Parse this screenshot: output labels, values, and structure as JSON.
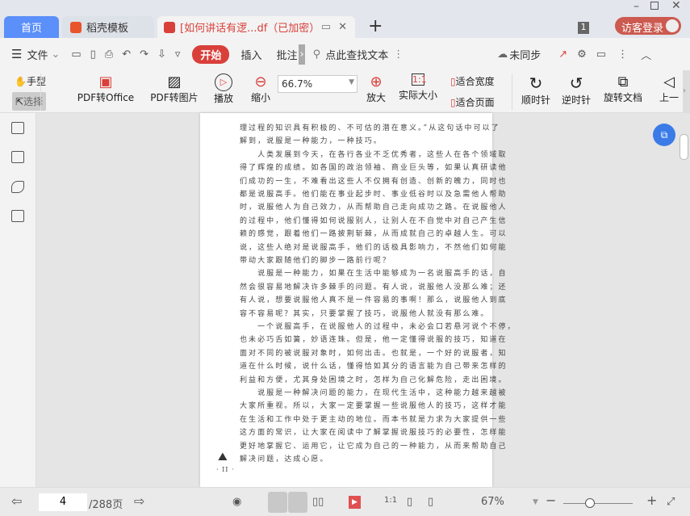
{
  "tabs": {
    "home": "首页",
    "template": "稻壳模板",
    "doc": "[如何讲话有逻...df（已加密）",
    "new": "+"
  },
  "window": {
    "badge": "1",
    "login": "访客登录"
  },
  "toolbar": {
    "menu": "文件",
    "start": "开始",
    "insert": "插入",
    "annotate": "批注",
    "search": "点此查找文本",
    "sync": "未同步"
  },
  "ribbon": {
    "hand": "手型",
    "select": "选择",
    "pdf_office": "PDF转Office",
    "pdf_image": "PDF转图片",
    "play": "播放",
    "zoom_out": "缩小",
    "zoom_value": "66.7%",
    "zoom_in": "放大",
    "actual": "实际大小",
    "fit_width": "适合宽度",
    "fit_page": "适合页面",
    "clockwise": "顺时针",
    "counter": "逆时针",
    "rotate_doc": "旋转文档",
    "prev": "上一"
  },
  "page": {
    "lines": [
      "理过程的知识具有积极的、不可估的潜在意义。”从这句话中可以了",
      "解到，说服是一种能力，一种技巧。",
      "　　人类发展到今天，在各行各业不乏优秀者，这些人在各个领域取",
      "得了辉煌的成绩。如各国的政治领袖、商业巨头等，如果认真研读他",
      "们成功的一生，不难看出这些人不仅拥有创造、创新的魄力，同时也",
      "都是说服高手。他们能在事业起步时、事业低谷时以及急需他人帮助",
      "时，说服他人为自己效力，从而帮助自己走向成功之路。在说服他人",
      "的过程中，他们懂得如何说服别人，让别人在不自觉中对自己产生信",
      "赖的感觉，跟着他们一路披荆斩棘，从而成就自己的卓越人生。可以",
      "说，这些人绝对是说服高手，他们的话极具影响力，不然他们如何能",
      "带动大家跟随他们的脚步一路前行呢？",
      "　　说服是一种能力，如果在生活中能够成为一名说服高手的话，自",
      "然会很容易地解决许多棘手的问题。有人说，说服他人没那么难；还",
      "有人说，想要说服他人真不是一件容易的事啊！那么，说服他人到底",
      "容不容易呢？其实，只要掌握了技巧，说服他人就没有那么难。",
      "　　一个说服高手，在说服他人的过程中，未必会口若悬河说个不停，",
      "也未必巧舌如簧，妙语连珠。但是，他一定懂得说服的技巧，知道在",
      "面对不同的被说服对象时，如何出击。也就是，一个好的说服者，知",
      "道在什么时候，说什么话，懂得恰如其分的语言能为自己带来怎样的",
      "利益和方便，尤其身处困境之时，怎样为自己化解危险，走出困境。",
      "　　说服是一种解决问题的能力，在现代生活中，这种能力越来越被",
      "大家所重视。所以，大家一定要掌握一些说服他人的技巧，这样才能",
      "在生活和工作中处于更主动的地位。而本书就是力求为大家提供一些",
      "这方面的常识，让大家在阅读中了解掌握说服技巧的必要性，怎样能",
      "更好地掌握它、运用它，让它成为自己的一种能力，从而来帮助自己",
      "解决问题，达成心愿。"
    ],
    "folio": "· II ·"
  },
  "status": {
    "page": "4",
    "total": "/288页",
    "zoom": "67%"
  },
  "colors": {
    "accent": "#d9403a",
    "tab_home": "#5b8ff9"
  }
}
